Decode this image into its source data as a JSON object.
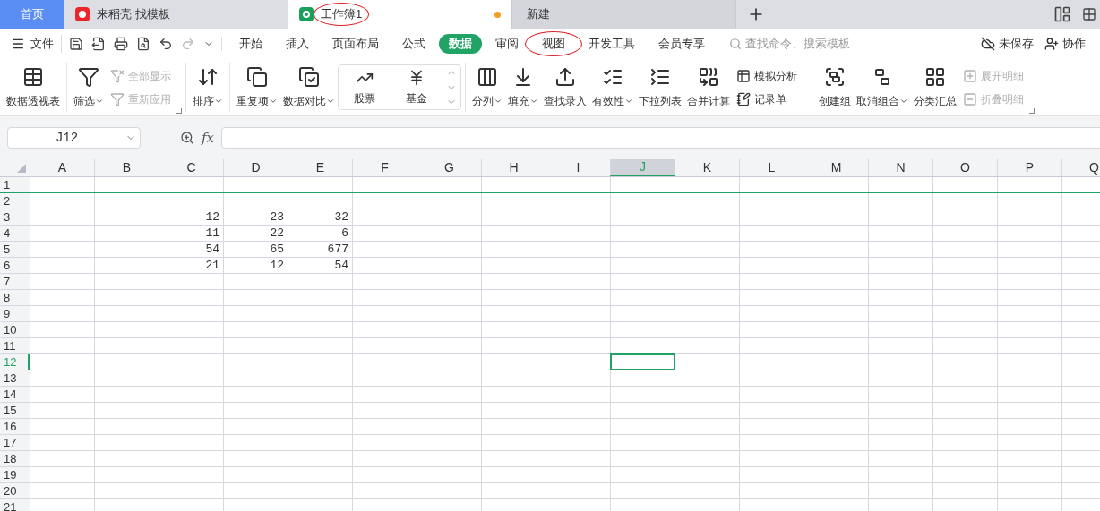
{
  "tabs": [
    {
      "label": "首页",
      "kind": "home",
      "selected": false,
      "circled": false
    },
    {
      "label": "来稻壳 找模板",
      "kind": "docer",
      "selected": false,
      "circled": false
    },
    {
      "label": "工作簿1",
      "kind": "sheet",
      "selected": true,
      "circled": true,
      "unsaved": true
    },
    {
      "label": "新建",
      "kind": "new",
      "selected": false,
      "circled": false
    }
  ],
  "menu": {
    "file": "文件",
    "items": [
      {
        "label": "开始",
        "selected": false,
        "circled": false
      },
      {
        "label": "插入",
        "selected": false,
        "circled": false
      },
      {
        "label": "页面布局",
        "selected": false,
        "circled": false
      },
      {
        "label": "公式",
        "selected": false,
        "circled": false
      },
      {
        "label": "数据",
        "selected": true,
        "circled": false
      },
      {
        "label": "审阅",
        "selected": false,
        "circled": false
      },
      {
        "label": "视图",
        "selected": false,
        "circled": true
      },
      {
        "label": "开发工具",
        "selected": false,
        "circled": false
      },
      {
        "label": "会员专享",
        "selected": false,
        "circled": false
      }
    ],
    "search_placeholder": "查找命令、搜索模板",
    "save_status": "未保存",
    "collab": "协作"
  },
  "ribbon": [
    {
      "kind": "large",
      "label": "数据透视表",
      "dropdown": false,
      "disabled": false
    },
    {
      "kind": "sep"
    },
    {
      "kind": "large",
      "label": "筛选",
      "dropdown": true,
      "disabled": false
    },
    {
      "kind": "small",
      "items": [
        {
          "label": "全部显示",
          "disabled": true
        },
        {
          "label": "重新应用",
          "disabled": true
        }
      ],
      "launcher": true
    },
    {
      "kind": "sep"
    },
    {
      "kind": "large",
      "label": "排序",
      "dropdown": true,
      "disabled": false
    },
    {
      "kind": "sep"
    },
    {
      "kind": "large",
      "label": "重复项",
      "dropdown": true,
      "disabled": false
    },
    {
      "kind": "large",
      "label": "数据对比",
      "dropdown": true,
      "disabled": false
    },
    {
      "kind": "gallery",
      "items": [
        "股票",
        "基金"
      ]
    },
    {
      "kind": "sep"
    },
    {
      "kind": "large",
      "label": "分列",
      "dropdown": true,
      "disabled": false
    },
    {
      "kind": "large",
      "label": "填充",
      "dropdown": true,
      "disabled": false
    },
    {
      "kind": "large",
      "label": "查找录入",
      "dropdown": false,
      "disabled": false
    },
    {
      "kind": "large",
      "label": "有效性",
      "dropdown": true,
      "disabled": false
    },
    {
      "kind": "large",
      "label": "下拉列表",
      "dropdown": false,
      "disabled": false
    },
    {
      "kind": "large",
      "label": "合并计算",
      "dropdown": false,
      "disabled": false
    },
    {
      "kind": "small",
      "items": [
        {
          "label": "模拟分析",
          "disabled": false
        },
        {
          "label": "记录单",
          "disabled": false
        }
      ],
      "launcher": false
    },
    {
      "kind": "sep"
    },
    {
      "kind": "large",
      "label": "创建组",
      "dropdown": false,
      "disabled": false
    },
    {
      "kind": "large",
      "label": "取消组合",
      "dropdown": true,
      "disabled": false
    },
    {
      "kind": "large",
      "label": "分类汇总",
      "dropdown": false,
      "disabled": false
    },
    {
      "kind": "small",
      "items": [
        {
          "label": "展开明细",
          "disabled": true
        },
        {
          "label": "折叠明细",
          "disabled": true
        }
      ],
      "launcher": true
    }
  ],
  "name_box": "J12",
  "function_label": "fx",
  "columns": [
    {
      "label": "A",
      "selected": false
    },
    {
      "label": "B",
      "selected": false
    },
    {
      "label": "C",
      "selected": false
    },
    {
      "label": "D",
      "selected": false
    },
    {
      "label": "E",
      "selected": false
    },
    {
      "label": "F",
      "selected": false
    },
    {
      "label": "G",
      "selected": false
    },
    {
      "label": "H",
      "selected": false
    },
    {
      "label": "I",
      "selected": false
    },
    {
      "label": "J",
      "selected": true
    },
    {
      "label": "K",
      "selected": false
    },
    {
      "label": "L",
      "selected": false
    },
    {
      "label": "M",
      "selected": false
    },
    {
      "label": "N",
      "selected": false
    },
    {
      "label": "O",
      "selected": false
    },
    {
      "label": "P",
      "selected": false
    },
    {
      "label": "Q",
      "selected": false
    }
  ],
  "rows": [
    {
      "label": "1",
      "selected": false,
      "freeze_line": true
    },
    {
      "label": "2",
      "selected": false
    },
    {
      "label": "3",
      "selected": false,
      "cells": [
        null,
        null,
        "12",
        "23",
        "32"
      ]
    },
    {
      "label": "4",
      "selected": false,
      "cells": [
        null,
        null,
        "11",
        "22",
        "6"
      ]
    },
    {
      "label": "5",
      "selected": false,
      "cells": [
        null,
        null,
        "54",
        "65",
        "677"
      ]
    },
    {
      "label": "6",
      "selected": false,
      "cells": [
        null,
        null,
        "21",
        "12",
        "54"
      ]
    },
    {
      "label": "7",
      "selected": false
    },
    {
      "label": "8",
      "selected": false
    },
    {
      "label": "9",
      "selected": false
    },
    {
      "label": "10",
      "selected": false
    },
    {
      "label": "11",
      "selected": false
    },
    {
      "label": "12",
      "selected": true
    },
    {
      "label": "13",
      "selected": false
    },
    {
      "label": "14",
      "selected": false
    },
    {
      "label": "15",
      "selected": false
    },
    {
      "label": "16",
      "selected": false
    },
    {
      "label": "17",
      "selected": false
    },
    {
      "label": "18",
      "selected": false
    },
    {
      "label": "19",
      "selected": false
    },
    {
      "label": "20",
      "selected": false
    },
    {
      "label": "21",
      "selected": false
    }
  ]
}
